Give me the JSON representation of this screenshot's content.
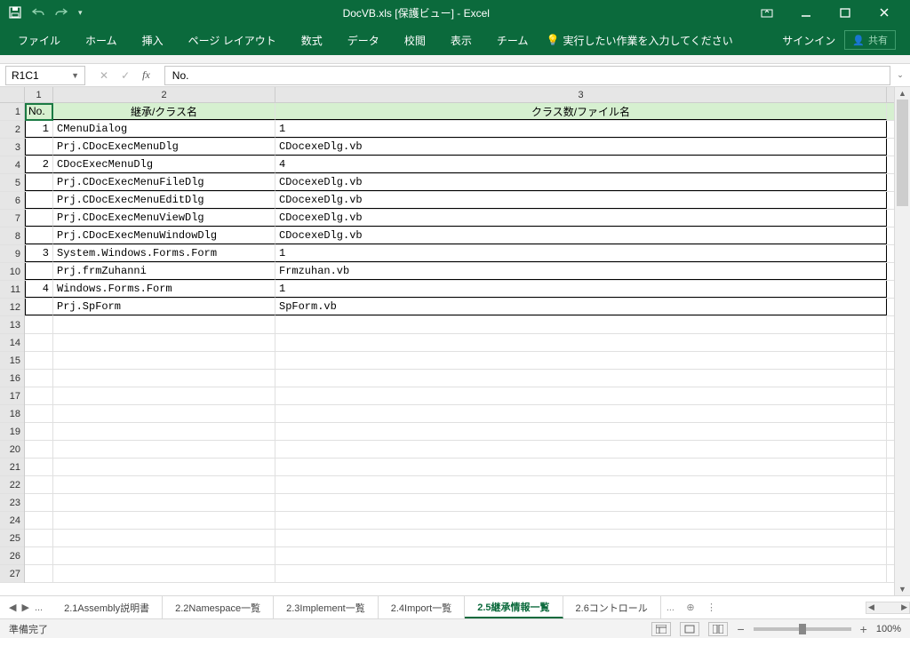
{
  "title": "DocVB.xls  [保護ビュー] - Excel",
  "qat": {
    "save": "save-icon",
    "undo": "undo-icon",
    "redo": "redo-icon"
  },
  "winbtns": {
    "ribbon_opts": "ribbon-options-icon",
    "min": "minimize-icon",
    "max": "maximize-icon",
    "close": "close-icon"
  },
  "tabs": [
    "ファイル",
    "ホーム",
    "挿入",
    "ページ レイアウト",
    "数式",
    "データ",
    "校閲",
    "表示",
    "チーム"
  ],
  "tellme": "実行したい作業を入力してください",
  "signin": "サインイン",
  "share": "共有",
  "namebox": "R1C1",
  "formula": "No.",
  "col_headers": [
    "1",
    "2",
    "3"
  ],
  "row_headers": [
    "1",
    "2",
    "3",
    "4",
    "5",
    "6",
    "7",
    "8",
    "9",
    "10",
    "11",
    "12",
    "13",
    "14",
    "15",
    "16",
    "17",
    "18",
    "19",
    "20",
    "21",
    "22",
    "23",
    "24",
    "25",
    "26",
    "27"
  ],
  "header_row": {
    "c1": "No.",
    "c2": "継承/クラス名",
    "c3": "クラス数/ファイル名"
  },
  "rows": [
    {
      "no": "1",
      "c2": "CMenuDialog",
      "c3": "1"
    },
    {
      "no": "",
      "c2": "Prj.CDocExecMenuDlg",
      "c3": "CDocexeDlg.vb"
    },
    {
      "no": "2",
      "c2": "CDocExecMenuDlg",
      "c3": "4"
    },
    {
      "no": "",
      "c2": "Prj.CDocExecMenuFileDlg",
      "c3": "CDocexeDlg.vb"
    },
    {
      "no": "",
      "c2": "Prj.CDocExecMenuEditDlg",
      "c3": "CDocexeDlg.vb"
    },
    {
      "no": "",
      "c2": "Prj.CDocExecMenuViewDlg",
      "c3": "CDocexeDlg.vb"
    },
    {
      "no": "",
      "c2": "Prj.CDocExecMenuWindowDlg",
      "c3": "CDocexeDlg.vb"
    },
    {
      "no": "3",
      "c2": "System.Windows.Forms.Form",
      "c3": "1"
    },
    {
      "no": "",
      "c2": "Prj.frmZuhanni",
      "c3": "Frmzuhan.vb"
    },
    {
      "no": "4",
      "c2": "Windows.Forms.Form",
      "c3": "1"
    },
    {
      "no": "",
      "c2": "Prj.SpForm",
      "c3": "SpForm.vb"
    }
  ],
  "sheets": {
    "ellipsis": "...",
    "list": [
      "2.1Assembly説明書",
      "2.2Namespace一覧",
      "2.3Implement一覧",
      "2.4Import一覧",
      "2.5継承情報一覧",
      "2.6コントロール"
    ],
    "active_index": 4,
    "more": "..."
  },
  "status": {
    "ready": "準備完了",
    "zoom": "100%"
  }
}
